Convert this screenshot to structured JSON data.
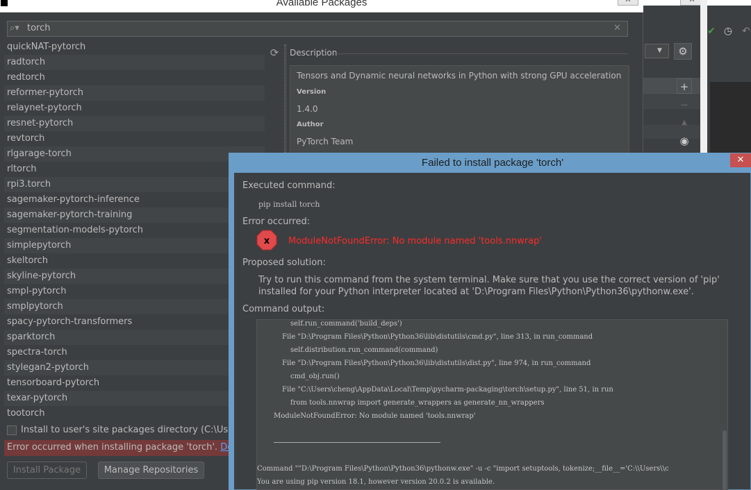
{
  "main_dialog": {
    "title": "Available Packages",
    "close_glyph": "✕",
    "search": {
      "value": "torch",
      "icon": "search-icon",
      "clear_glyph": "✕"
    },
    "packages": [
      "quickNAT-pytorch",
      "radtorch",
      "redtorch",
      "reformer-pytorch",
      "relaynet-pytorch",
      "resnet-pytorch",
      "revtorch",
      "rlgarage-torch",
      "rltorch",
      "rpi3.torch",
      "sagemaker-pytorch-inference",
      "sagemaker-pytorch-training",
      "segmentation-models-pytorch",
      "simplepytorch",
      "skeltorch",
      "skyline-pytorch",
      "smpl-pytorch",
      "smplpytorch",
      "spacy-pytorch-transformers",
      "sparktorch",
      "spectra-torch",
      "stylegan2-pytorch",
      "tensorboard-pytorch",
      "texar-pytorch",
      "tootorch"
    ],
    "refresh_glyph": "⟳",
    "description": {
      "heading": "Description",
      "text": "Tensors and Dynamic neural networks in Python with strong GPU acceleration",
      "version_label": "Version",
      "version_value": "1.4.0",
      "author_label": "Author",
      "author_value": "PyTorch Team"
    },
    "site_packages_label": "Install to user's site packages directory (C:\\Users\\ch",
    "error_bar": {
      "text": "Error occurred when installing package 'torch'. ",
      "link": "Details."
    },
    "install_button": "Install Package",
    "manage_button": "Manage Repositories"
  },
  "background": {
    "close_glyph": "✕",
    "gear_glyph": "⚙",
    "plus_glyph": "+",
    "minus_glyph": "−",
    "up_glyph": "▲",
    "eye_glyph": "◉",
    "check_glyph": "✔",
    "history_glyph": "◷",
    "undo_glyph": "↶",
    "combo_arrow": "▼"
  },
  "error_dialog": {
    "title": "Failed to install package 'torch'",
    "close_glyph": "✕",
    "executed_label": "Executed command:",
    "command": "pip install torch",
    "error_label": "Error occurred:",
    "error_icon_text": "x",
    "error_message": "ModuleNotFoundError: No module named 'tools.nnwrap'",
    "solution_label": "Proposed solution:",
    "solution_text": "Try to run this command from the system terminal. Make sure that you use the correct version of 'pip' installed for your Python interpreter located at 'D:\\Program Files\\Python\\Python36\\pythonw.exe'.",
    "output_label": "Command output:",
    "output_lines": [
      "self.run_command('build_deps')",
      "File \"D:\\Program Files\\Python\\Python36\\lib\\distutils\\cmd.py\", line 313, in run_command",
      "self.distribution.run_command(command)",
      "File \"D:\\Program Files\\Python\\Python36\\lib\\distutils\\dist.py\", line 974, in run_command",
      "cmd_obj.run()",
      "File \"C:\\Users\\cheng\\AppData\\Local\\Temp\\pycharm-packaging\\torch\\setup.py\", line 51, in run",
      "from tools.nnwrap import generate_wrappers as generate_nn_wrappers",
      "ModuleNotFoundError: No module named 'tools.nnwrap'",
      "Command \"\"D:\\Program Files\\Python\\Python36\\pythonw.exe\" -u -c \"import setuptools, tokenize;__file__='C:\\\\Users\\\\c",
      "You are using pip version 18.1, however version 20.0.2 is available."
    ]
  }
}
